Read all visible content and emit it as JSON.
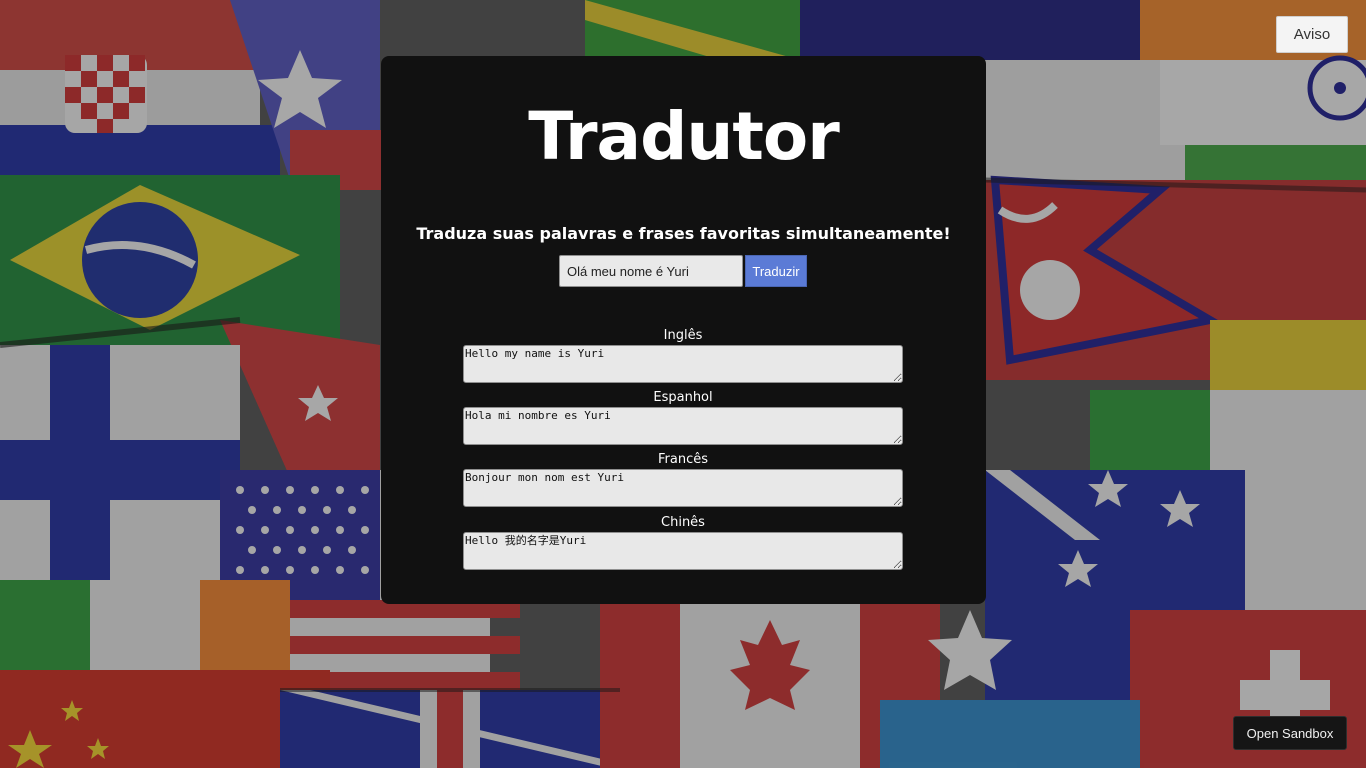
{
  "header": {
    "aviso_label": "Aviso"
  },
  "app": {
    "title": "Tradutor",
    "subtitle": "Traduza suas palavras e frases favoritas simultaneamente!"
  },
  "search": {
    "value": "Olá meu nome é Yuri",
    "button_label": "Traduzir"
  },
  "translations": [
    {
      "language": "Inglês",
      "text": "Hello my name is Yuri"
    },
    {
      "language": "Espanhol",
      "text": "Hola mi nombre es Yuri"
    },
    {
      "language": "Francês",
      "text": "Bonjour mon nom est Yuri"
    },
    {
      "language": "Chinês",
      "text": "Hello 我的名字是Yuri"
    }
  ],
  "footer": {
    "sandbox_label": "Open Sandbox"
  },
  "colors": {
    "panel": "#111111",
    "button_accent": "#5b7bd6",
    "output_bg": "#e8e8e8"
  },
  "background": {
    "icon": "world-flags-background"
  }
}
